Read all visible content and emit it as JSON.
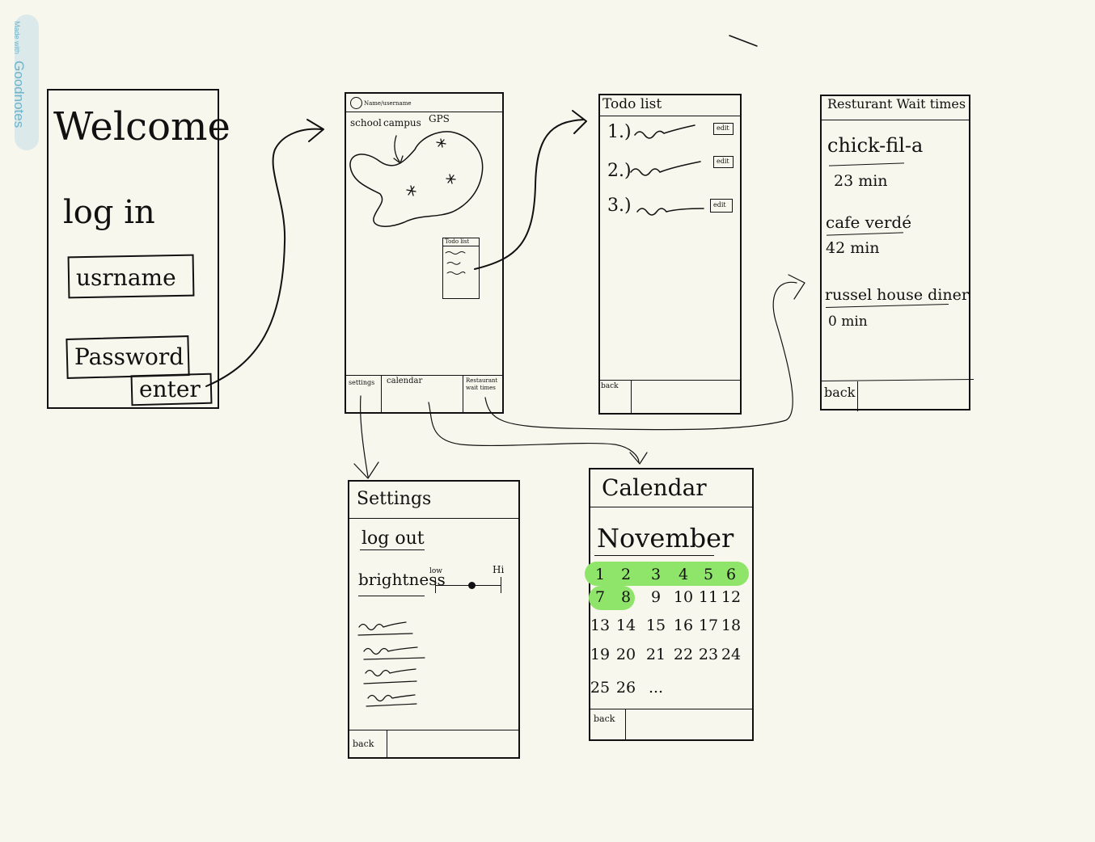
{
  "badge": {
    "made_with": "Made with",
    "brand": "Goodnotes"
  },
  "login": {
    "title": "Welcome",
    "subtitle": "log in",
    "username_label": "usrname",
    "password_label": "Password",
    "enter_label": "enter"
  },
  "home": {
    "profile_label": "Name/username",
    "map_label_school": "school",
    "map_label_campus": "campus",
    "map_label_gps": "GPS",
    "mini_todo_title": "Todo list",
    "nav_settings": "settings",
    "nav_calendar": "calendar",
    "nav_restaurant": "Restaurant wait times"
  },
  "todo": {
    "title": "Todo list",
    "items": [
      {
        "number": "1.)",
        "edit": "edit"
      },
      {
        "number": "2.)",
        "edit": "edit"
      },
      {
        "number": "3.)",
        "edit": "edit"
      }
    ],
    "back": "back"
  },
  "restaurant": {
    "title": "Resturant Wait times",
    "entries": [
      {
        "name": "chick-fil-a",
        "wait": "23 min"
      },
      {
        "name": "cafe verdé",
        "wait": "42 min"
      },
      {
        "name": "russel house diner",
        "wait": "0 min"
      }
    ],
    "back": "back"
  },
  "settings": {
    "title": "Settings",
    "logout": "log out",
    "brightness": "brightness",
    "slider_low": "low",
    "slider_high": "Hi",
    "brightness_level": 0.55,
    "back": "back"
  },
  "calendar": {
    "title": "Calendar",
    "month": "November",
    "rows": [
      [
        "1",
        "2",
        "3",
        "4",
        "5",
        "6"
      ],
      [
        "7",
        "8",
        "9",
        "10",
        "11",
        "12"
      ],
      [
        "13",
        "14",
        "15",
        "16",
        "17",
        "18"
      ],
      [
        "19",
        "20",
        "21",
        "22",
        "23",
        "24"
      ],
      [
        "25",
        "26",
        "..."
      ]
    ],
    "highlighted_days": [
      "1",
      "2",
      "3",
      "4",
      "5",
      "6",
      "7",
      "8"
    ],
    "highlight_color": "#8fe56a",
    "back": "back"
  },
  "colors": {
    "paper": "#f8f7ed",
    "ink": "#111111",
    "badge": "#6fb3c8"
  }
}
